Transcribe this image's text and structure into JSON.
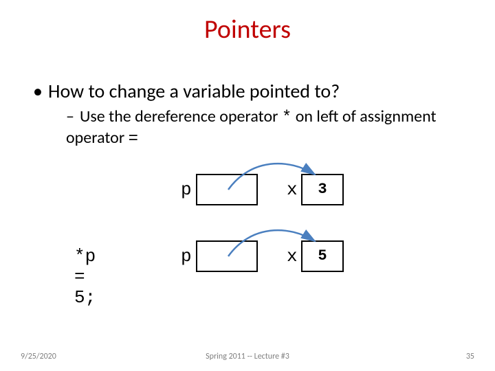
{
  "title": "Pointers",
  "bullets": {
    "level1": "How to change a variable pointed to?",
    "level2_part1": "Use the dereference operator ",
    "level2_op1": "*",
    "level2_part2": " on left of assignment operator ",
    "level2_op2": "="
  },
  "diagram": {
    "row1": {
      "p_label": "p",
      "x_label": "x",
      "x_value": "3"
    },
    "row2": {
      "code": "*p = 5;",
      "p_label": "p",
      "x_label": "x",
      "x_value": "5"
    }
  },
  "footer": {
    "date": "9/25/2020",
    "center": "Spring 2011 -- Lecture #3",
    "pageno": "35"
  }
}
